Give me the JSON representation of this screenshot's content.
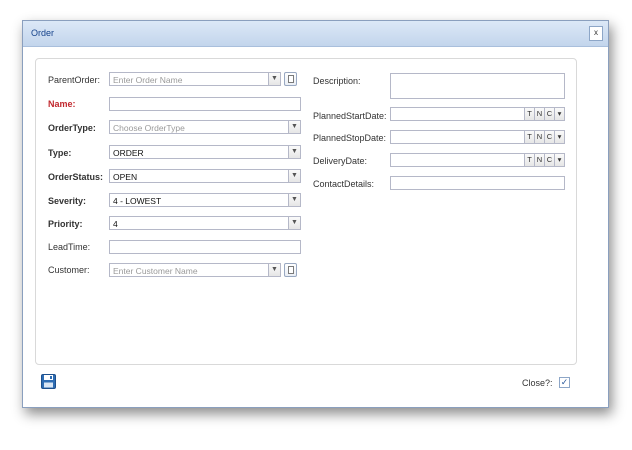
{
  "dialog": {
    "title": "Order",
    "close_label": "x"
  },
  "left": {
    "parent_order": {
      "label": "ParentOrder:",
      "placeholder": "Enter Order Name"
    },
    "name": {
      "label": "Name:",
      "value": ""
    },
    "order_type": {
      "label": "OrderType:",
      "placeholder": "Choose OrderType"
    },
    "type": {
      "label": "Type:",
      "value": "ORDER"
    },
    "order_status": {
      "label": "OrderStatus:",
      "value": "OPEN"
    },
    "severity": {
      "label": "Severity:",
      "value": "4 - LOWEST"
    },
    "priority": {
      "label": "Priority:",
      "value": "4"
    },
    "lead_time": {
      "label": "LeadTime:",
      "value": ""
    },
    "customer": {
      "label": "Customer:",
      "placeholder": "Enter Customer Name"
    }
  },
  "right": {
    "description": {
      "label": "Description:",
      "value": ""
    },
    "planned_start": {
      "label": "PlannedStartDate:",
      "value": ""
    },
    "planned_stop": {
      "label": "PlannedStopDate:",
      "value": ""
    },
    "delivery": {
      "label": "DeliveryDate:",
      "value": ""
    },
    "contact": {
      "label": "ContactDetails:",
      "value": ""
    },
    "date_buttons": {
      "t": "T",
      "n": "N",
      "c": "C"
    }
  },
  "footer": {
    "save_icon": "floppy-disk-icon",
    "close_label": "Close?:",
    "close_checked": "✓"
  },
  "colors": {
    "required_label": "#c1272d",
    "title_text": "#15428b",
    "title_bar": "#c3d5ec"
  }
}
